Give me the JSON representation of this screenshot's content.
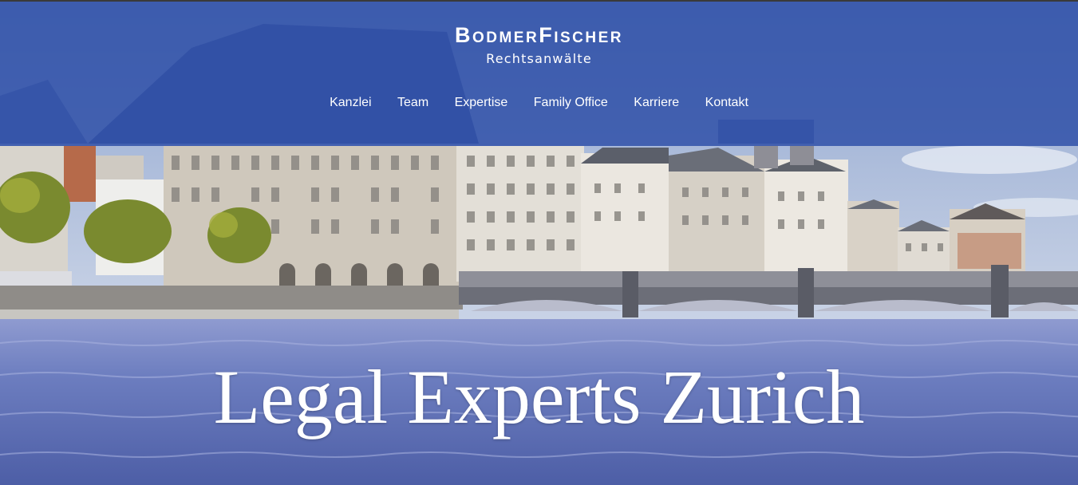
{
  "brand": {
    "name": "BodmerFischer",
    "tagline": "Rechtsanwälte"
  },
  "nav": {
    "items": [
      {
        "label": "Kanzlei"
      },
      {
        "label": "Team"
      },
      {
        "label": "Expertise"
      },
      {
        "label": "Family Office"
      },
      {
        "label": "Karriere"
      },
      {
        "label": "Kontakt"
      }
    ]
  },
  "hero": {
    "title": "Legal Experts Zurich",
    "image_subject": "Zurich riverfront with Limmat river and stone bridge"
  },
  "colors": {
    "header_overlay": "#284aa5",
    "text": "#ffffff",
    "water": "#5f70b3"
  }
}
